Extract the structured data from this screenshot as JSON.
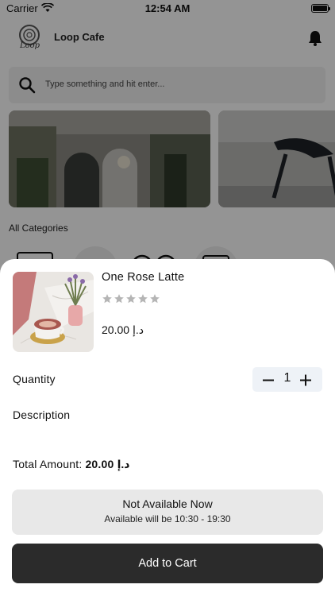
{
  "status_bar": {
    "carrier": "Carrier",
    "time": "12:54 AM",
    "icons": [
      "wifi-icon",
      "battery-icon"
    ]
  },
  "header": {
    "logo_text": "Loop",
    "cafe_name": "Loop Cafe",
    "icon": "bell-icon"
  },
  "search": {
    "placeholder": "Type something and hit enter...",
    "icon": "search-icon"
  },
  "categories": {
    "title": "All Categories"
  },
  "product": {
    "name": "One Rose Latte",
    "rating": 0,
    "max_rating": 5,
    "price": "20.00 د.إ"
  },
  "quantity": {
    "label": "Quantity",
    "value": "1"
  },
  "description": {
    "label": "Description"
  },
  "total": {
    "label": "Total Amount:",
    "value": "20.00 د.إ"
  },
  "availability": {
    "title": "Not Available Now",
    "subtitle": "Available will be 10:30 - 19:30"
  },
  "actions": {
    "add_to_cart": "Add to Cart"
  },
  "colors": {
    "primary_button": "#2b2b2b",
    "availability_bg": "#e8e8e8",
    "stepper_bg": "#eef2f7",
    "star_empty": "#b5b5b5"
  }
}
